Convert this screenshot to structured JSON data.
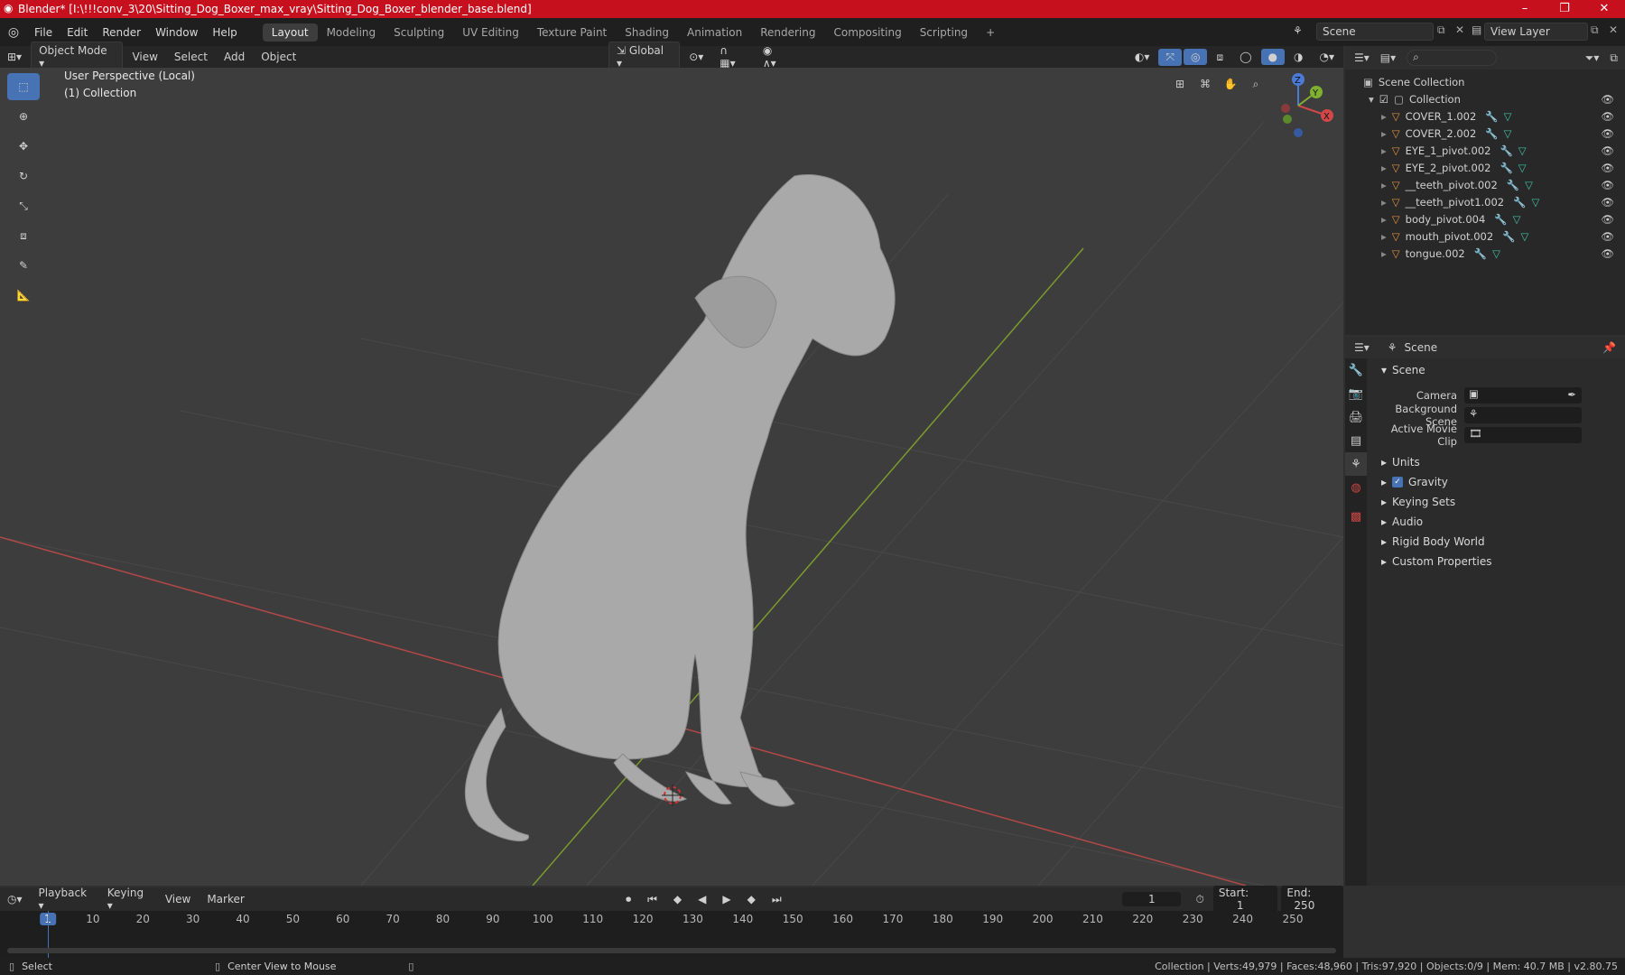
{
  "window": {
    "title": "Blender* [I:\\!!!conv_3\\20\\Sitting_Dog_Boxer_max_vray\\Sitting_Dog_Boxer_blender_base.blend]",
    "minimize": "–",
    "maximize": "❐",
    "close": "✕"
  },
  "menu": [
    "File",
    "Edit",
    "Render",
    "Window",
    "Help"
  ],
  "workspaces": [
    "Layout",
    "Modeling",
    "Sculpting",
    "UV Editing",
    "Texture Paint",
    "Shading",
    "Animation",
    "Rendering",
    "Compositing",
    "Scripting"
  ],
  "workspace_add": "+",
  "scene_name": "Scene",
  "view_layer": "View Layer",
  "viewport_header": {
    "mode": "Object Mode",
    "menus": [
      "View",
      "Select",
      "Add",
      "Object"
    ],
    "orientation": "Global"
  },
  "viewport": {
    "perspective": "User Perspective (Local)",
    "collection": "(1) Collection",
    "gizmo_axes": [
      "X",
      "Y",
      "Z"
    ]
  },
  "outliner": {
    "root": "Scene Collection",
    "collection": "Collection",
    "items": [
      "COVER_1.002",
      "COVER_2.002",
      "EYE_1_pivot.002",
      "EYE_2_pivot.002",
      "__teeth_pivot.002",
      "__teeth_pivot1.002",
      "body_pivot.004",
      "mouth_pivot.002",
      "tongue.002"
    ]
  },
  "properties": {
    "context": "Scene",
    "section": "Scene",
    "fields": [
      {
        "label": "Camera",
        "value": ""
      },
      {
        "label": "Background Scene",
        "value": ""
      },
      {
        "label": "Active Movie Clip",
        "value": ""
      }
    ],
    "panels": [
      "Units",
      "Gravity",
      "Keying Sets",
      "Audio",
      "Rigid Body World",
      "Custom Properties"
    ],
    "gravity_checked": true
  },
  "timeline": {
    "menus": [
      "Playback",
      "Keying",
      "View",
      "Marker"
    ],
    "current_frame": "1",
    "start_label": "Start:",
    "start": "1",
    "end_label": "End:",
    "end": "250",
    "ruler": [
      "1",
      "10",
      "20",
      "30",
      "40",
      "50",
      "60",
      "70",
      "80",
      "90",
      "100",
      "110",
      "120",
      "130",
      "140",
      "150",
      "160",
      "170",
      "180",
      "190",
      "200",
      "210",
      "220",
      "230",
      "240",
      "250"
    ]
  },
  "status": {
    "select": "Select",
    "center": "Center View to Mouse",
    "stats": "Collection | Verts:49,979 | Faces:48,960 | Tris:97,920 | Objects:0/9 | Mem: 40.7 MB | v2.80.75"
  },
  "colors": {
    "titlebar": "#c7101d",
    "accent": "#4772b3",
    "x_axis": "#c24a4a",
    "y_axis": "#7a9a2e",
    "mesh_icon": "#e09040",
    "modifier_icon": "#5a9ae0",
    "data_icon": "#40c0a0"
  }
}
